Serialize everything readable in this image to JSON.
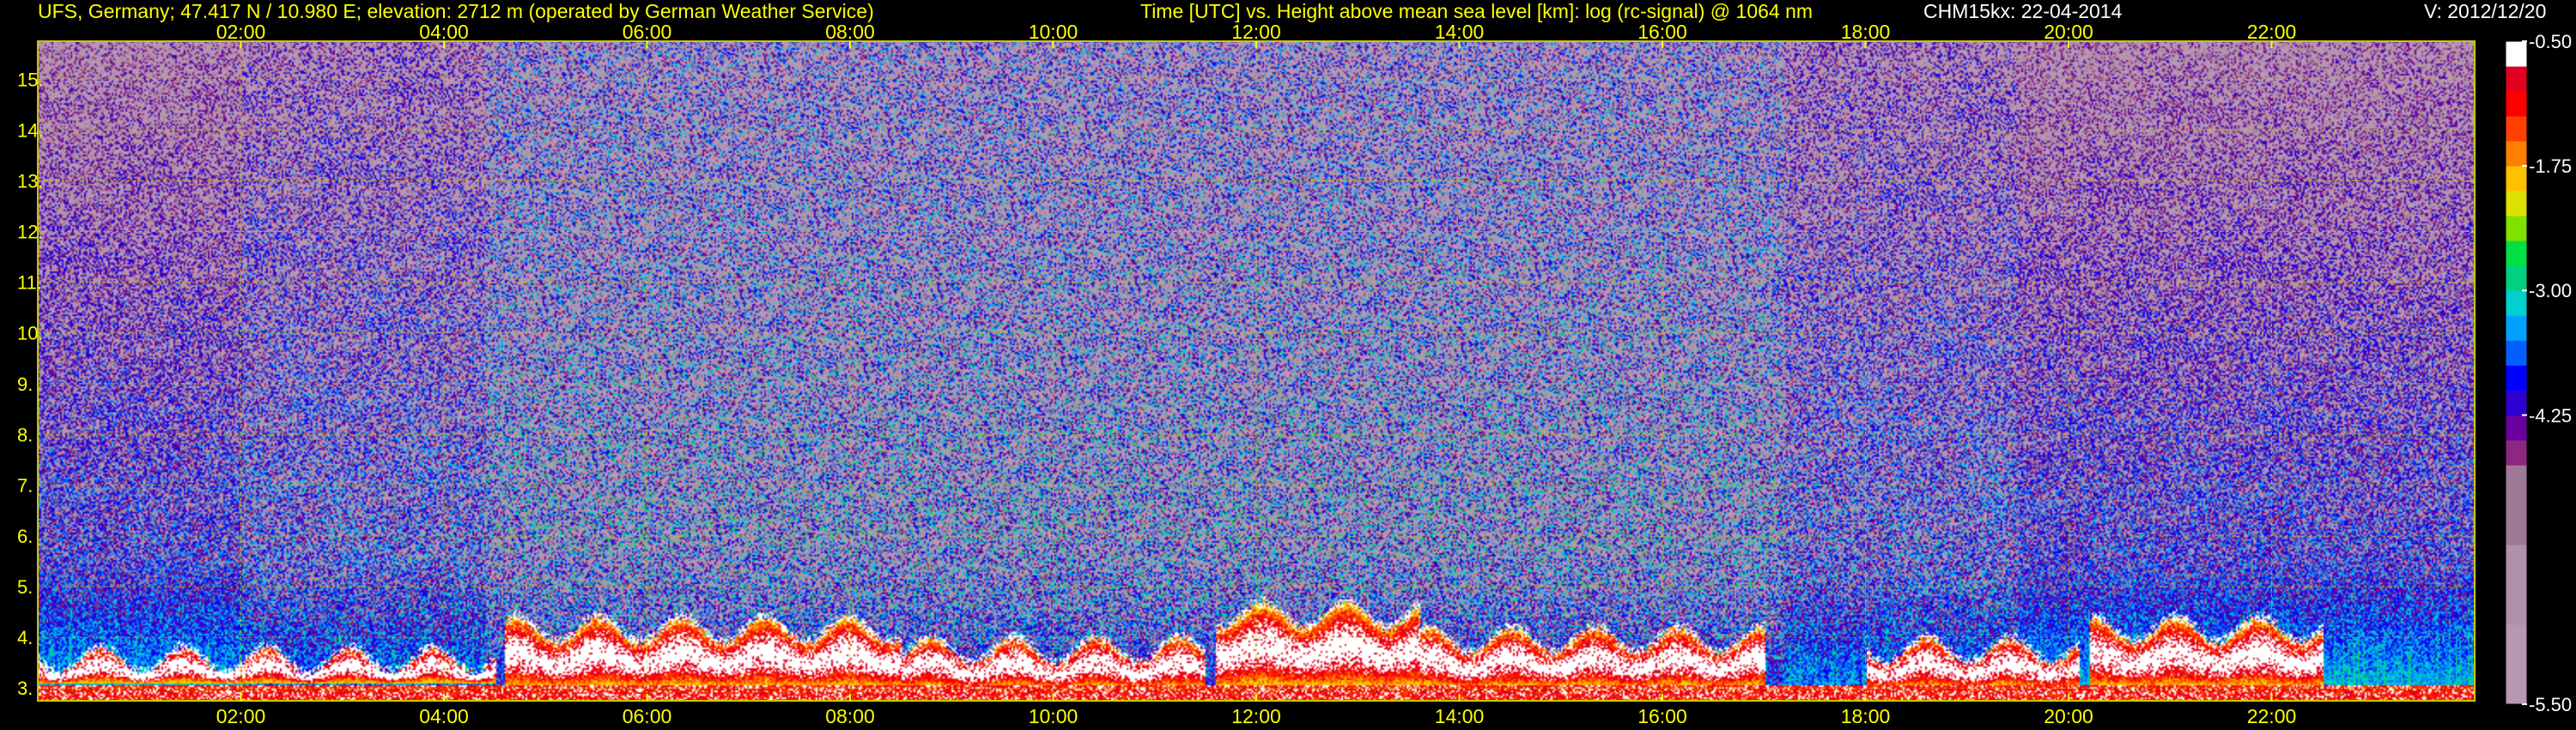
{
  "header": {
    "station": "UFS, Germany; 47.417 N / 10.980 E; elevation: 2712 m  (operated by German Weather Service)",
    "description": "Time [UTC] vs. Height above mean sea level [km]: log (rc-signal) @ 1064 nm",
    "instrument": "CHM15kx: 22-04-2014",
    "version": "V: 2012/12/20"
  },
  "colors": {
    "text_yellow": "#ffff00",
    "text_white": "#ffffff",
    "grid": "#c8c800",
    "background": "#000000"
  },
  "chart_data": {
    "type": "heatmap",
    "x_ticks": [
      "02:00",
      "04:00",
      "06:00",
      "08:00",
      "10:00",
      "12:00",
      "14:00",
      "16:00",
      "18:00",
      "20:00",
      "22:00"
    ],
    "x_tick_hours": [
      2,
      4,
      6,
      8,
      10,
      12,
      14,
      16,
      18,
      20,
      22
    ],
    "xlim": [
      0,
      24
    ],
    "y_ticks": [
      "3.",
      "4.",
      "5.",
      "6.",
      "7.",
      "8.",
      "9.",
      "10.",
      "11.",
      "12.",
      "13.",
      "14.",
      "15."
    ],
    "y_tick_values": [
      3,
      4,
      5,
      6,
      7,
      8,
      9,
      10,
      11,
      12,
      13,
      14,
      15
    ],
    "ylim": [
      2.75,
      15.75
    ],
    "grid": true,
    "colorbar": {
      "tick_labels": [
        "-0.50",
        "-1.75",
        "-3.00",
        "-4.25",
        "-5.50"
      ],
      "tick_values": [
        -0.5,
        -1.75,
        -3.0,
        -4.25,
        -5.5
      ],
      "range": [
        -5.5,
        -0.5
      ],
      "colors": [
        "#b898b0",
        "#b090a8",
        "#a07898",
        "#8c2880",
        "#6a00a0",
        "#3000d0",
        "#0000ff",
        "#0060ff",
        "#00a0ff",
        "#00d0d0",
        "#00d080",
        "#00e040",
        "#80e000",
        "#e0e000",
        "#ffc000",
        "#ff8000",
        "#ff4000",
        "#ff0000",
        "#e00020",
        "#ffffff"
      ]
    },
    "cloud_layers": [
      {
        "start": 0.0,
        "end": 4.5,
        "base": 3.1,
        "top": 3.7
      },
      {
        "start": 4.6,
        "end": 8.5,
        "base": 3.0,
        "top": 4.3
      },
      {
        "start": 8.5,
        "end": 11.5,
        "base": 3.0,
        "top": 3.9
      },
      {
        "start": 11.6,
        "end": 13.6,
        "base": 3.0,
        "top": 4.6
      },
      {
        "start": 13.6,
        "end": 17.0,
        "base": 3.0,
        "top": 4.1
      },
      {
        "start": 18.0,
        "end": 20.1,
        "base": 3.0,
        "top": 3.9
      },
      {
        "start": 20.2,
        "end": 22.5,
        "base": 3.0,
        "top": 4.3
      }
    ]
  }
}
